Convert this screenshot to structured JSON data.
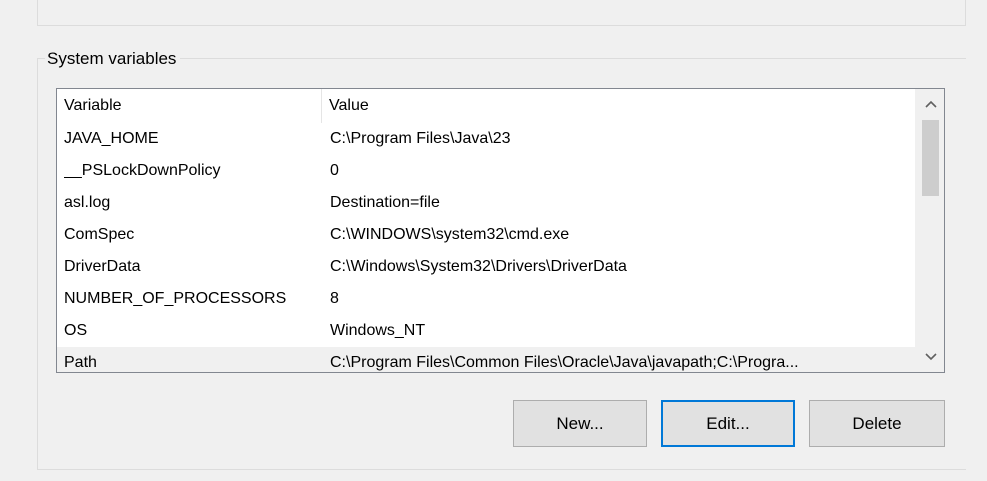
{
  "system_variables": {
    "group_title": "System variables",
    "columns": {
      "variable": "Variable",
      "value": "Value"
    },
    "rows": [
      {
        "variable": " JAVA_HOME",
        "value": "C:\\Program Files\\Java\\23"
      },
      {
        "variable": "__PSLockDownPolicy",
        "value": "0"
      },
      {
        "variable": "asl.log",
        "value": "Destination=file"
      },
      {
        "variable": "ComSpec",
        "value": "C:\\WINDOWS\\system32\\cmd.exe"
      },
      {
        "variable": "DriverData",
        "value": "C:\\Windows\\System32\\Drivers\\DriverData"
      },
      {
        "variable": "NUMBER_OF_PROCESSORS",
        "value": "8"
      },
      {
        "variable": "OS",
        "value": "Windows_NT"
      },
      {
        "variable": "Path",
        "value": "C:\\Program Files\\Common Files\\Oracle\\Java\\javapath;C:\\Progra..."
      }
    ],
    "selected_row_index": 7,
    "scroll_position": 0.1
  },
  "buttons": {
    "new_label": "New...",
    "edit_label": "Edit...",
    "delete_label": "Delete"
  },
  "icons": {
    "scroll_up": "chevron-up-icon",
    "scroll_down": "chevron-down-icon"
  }
}
